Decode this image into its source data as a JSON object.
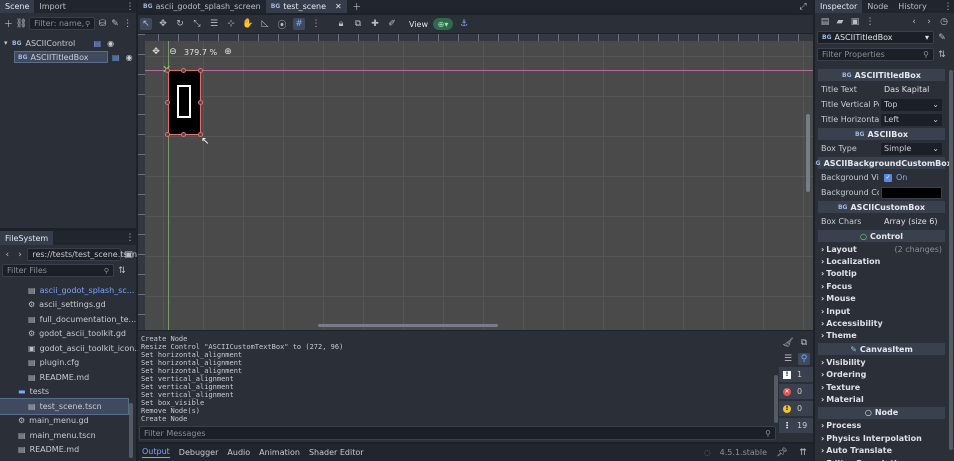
{
  "scene_dock": {
    "tabs": [
      "Scene",
      "Import"
    ],
    "filter_placeholder": "Filter: name, t:ty",
    "tree": [
      {
        "label": "ASCIIControl",
        "badge": "BG",
        "selected": false
      },
      {
        "label": "ASCIITitledBox",
        "badge": "BG",
        "selected": true
      }
    ]
  },
  "filesystem": {
    "title": "FileSystem",
    "path": "res://tests/test_scene.tscn",
    "filter_placeholder": "Filter Files",
    "items": [
      {
        "label": "ascii_godot_splash_sc...",
        "icon": "scene-icon",
        "indent": 2,
        "color": "#7aa7ff"
      },
      {
        "label": "ascii_settings.gd",
        "icon": "gear-icon",
        "indent": 2
      },
      {
        "label": "full_documentation_te...",
        "icon": "scene-icon",
        "indent": 2
      },
      {
        "label": "godot_ascii_toolkit.gd",
        "icon": "gear-icon",
        "indent": 2
      },
      {
        "label": "godot_ascii_toolkit_icon...",
        "icon": "badge-icon",
        "indent": 2
      },
      {
        "label": "plugin.cfg",
        "icon": "scene-icon",
        "indent": 2
      },
      {
        "label": "README.md",
        "icon": "scene-icon",
        "indent": 2
      },
      {
        "label": "tests",
        "icon": "folder-icon",
        "indent": 1
      },
      {
        "label": "test_scene.tscn",
        "icon": "scene-icon",
        "indent": 2,
        "selected": true
      },
      {
        "label": "main_menu.gd",
        "icon": "gear-icon",
        "indent": 1
      },
      {
        "label": "main_menu.tscn",
        "icon": "scene-icon",
        "indent": 1
      },
      {
        "label": "README.md",
        "icon": "scene-icon",
        "indent": 1
      }
    ]
  },
  "editor_tabs": [
    {
      "label": "ascii_godot_splash_screen",
      "active": false
    },
    {
      "label": "test_scene",
      "active": true
    }
  ],
  "toolbar": {
    "view_label": "View"
  },
  "viewport": {
    "zoom": "379.7 %"
  },
  "output": {
    "lines": [
      "Create Node",
      "Resize Control \"ASCIICustomTextBox\" to (272, 96)",
      "Set horizontal_alignment",
      "Set horizontal_alignment",
      "Set horizontal_alignment",
      "Set vertical_alignment",
      "Set vertical_alignment",
      "Set vertical_alignment",
      "Set box_visible",
      "Remove Node(s)",
      "Create Node"
    ],
    "filter_placeholder": "Filter Messages",
    "counts": {
      "info": "1",
      "errors": "0",
      "warnings": "0",
      "messages": "19"
    }
  },
  "bottom_tabs": [
    "Output",
    "Debugger",
    "Audio",
    "Animation",
    "Shader Editor"
  ],
  "version": "4.5.1.stable",
  "inspector": {
    "tabs": [
      "Inspector",
      "Node",
      "History"
    ],
    "node_name": "ASCIITitledBox",
    "filter_placeholder": "Filter Properties",
    "sections": {
      "titled": "ASCIITitledBox",
      "box": "ASCIIBox",
      "bg": "ASCIIBackgroundCustomBox",
      "custom": "ASCIICustomBox",
      "control": "Control",
      "canvas": "CanvasItem",
      "node": "Node"
    },
    "props": {
      "title_text": {
        "key": "Title Text",
        "value": "Das Kapital"
      },
      "title_vpos": {
        "key": "Title Vertical Pos",
        "value": "Top"
      },
      "title_halign": {
        "key": "Title Horizontal",
        "value": "Left"
      },
      "box_type": {
        "key": "Box Type",
        "value": "Simple"
      },
      "bg_visible": {
        "key": "Background Visi",
        "value": "On"
      },
      "bg_color": {
        "key": "Background Col",
        "color": "#000000"
      },
      "box_chars": {
        "key": "Box Chars",
        "value": "Array (size 6)"
      }
    },
    "control_groups": [
      {
        "label": "Layout",
        "note": "(2 changes)"
      },
      {
        "label": "Localization"
      },
      {
        "label": "Tooltip"
      },
      {
        "label": "Focus"
      },
      {
        "label": "Mouse"
      },
      {
        "label": "Input"
      },
      {
        "label": "Accessibility"
      },
      {
        "label": "Theme"
      }
    ],
    "canvas_groups": [
      {
        "label": "Visibility"
      },
      {
        "label": "Ordering"
      },
      {
        "label": "Texture"
      },
      {
        "label": "Material"
      }
    ],
    "node_groups": [
      {
        "label": "Process"
      },
      {
        "label": "Physics Interpolation"
      },
      {
        "label": "Auto Translate"
      },
      {
        "label": "Editor Description"
      }
    ]
  }
}
